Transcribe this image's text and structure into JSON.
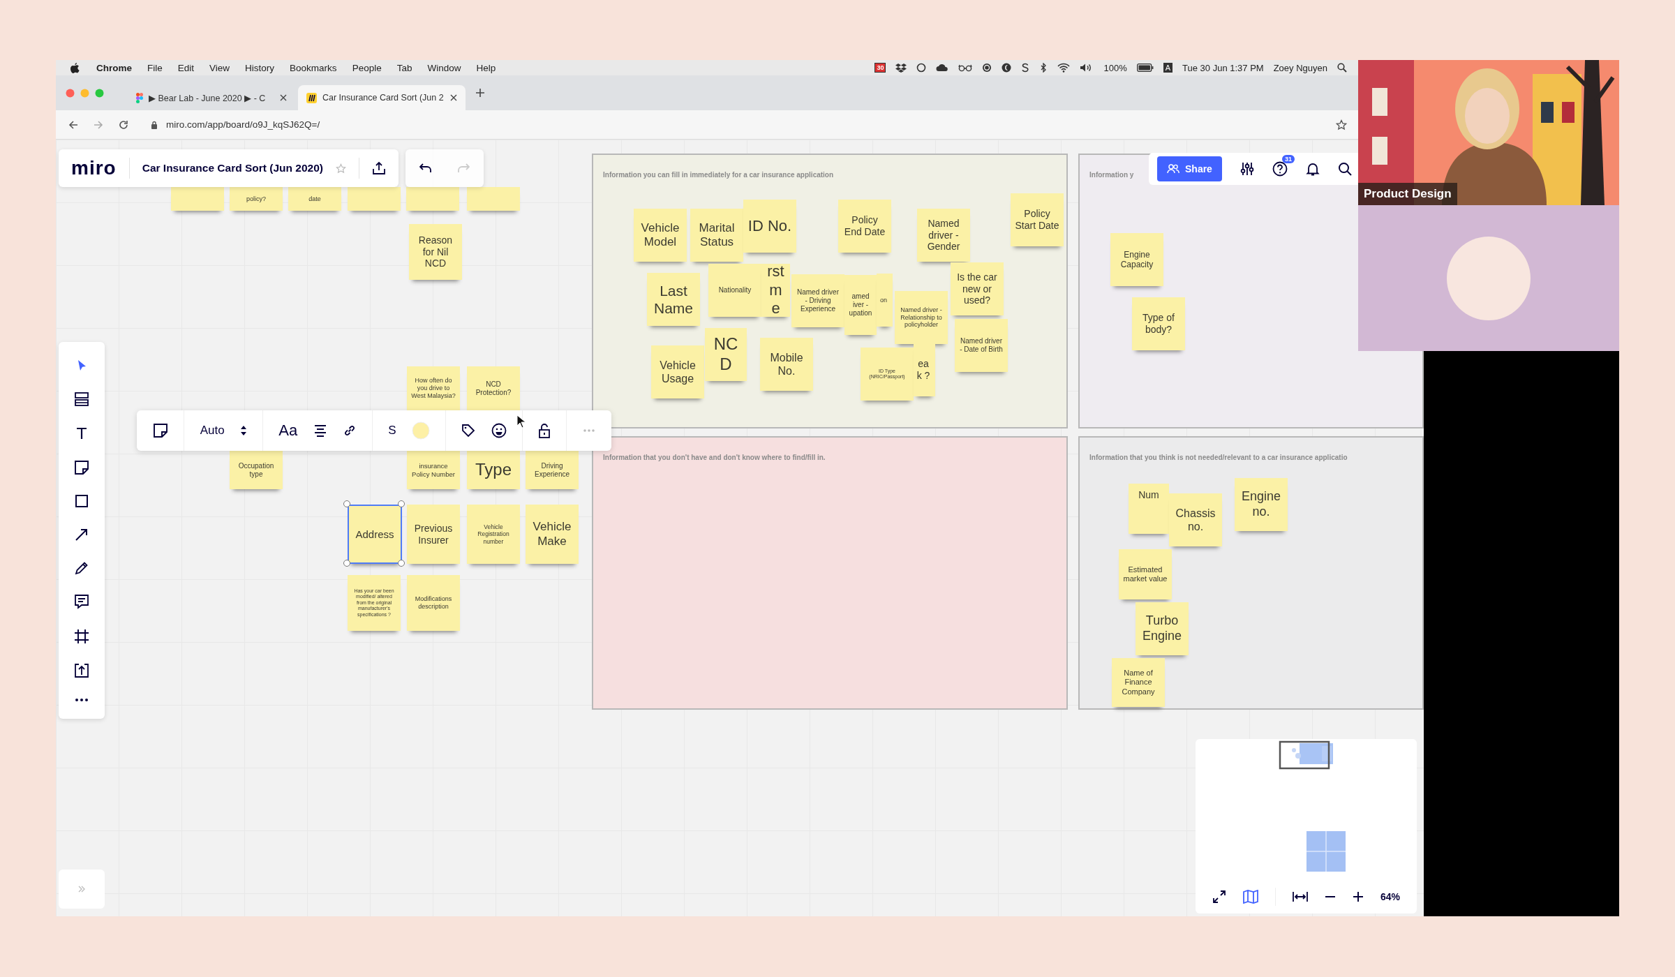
{
  "menu_bar": {
    "app": "Chrome",
    "menus": [
      "File",
      "Edit",
      "View",
      "History",
      "Bookmarks",
      "People",
      "Tab",
      "Window",
      "Help"
    ],
    "calendar_day": "30",
    "battery": "100%",
    "input_source": "A",
    "clock": "Tue 30 Jun 1:37 PM",
    "user": "Zoey Nguyen"
  },
  "tabs": [
    {
      "title": "▶ Bear Lab - June 2020 ▶ - C",
      "selected": false
    },
    {
      "title": "Car Insurance Card Sort (Jun 2",
      "selected": true
    }
  ],
  "address_bar": {
    "url": "miro.com/app/board/o9J_kqSJ62Q=/"
  },
  "board_header": {
    "logo": "miro",
    "title": "Car Insurance Card Sort (Jun 2020)",
    "share": "Share",
    "help_badge": "31"
  },
  "context_toolbar": {
    "font_size": "Auto",
    "font": "Aa",
    "shape": "S"
  },
  "loose_notes": [
    {
      "text": "policy?",
      "selected": false
    },
    {
      "text": "date",
      "selected": false
    },
    {
      "text": "Reason for Nil NCD",
      "selected": false
    },
    {
      "text": "How often do you drive to West Malaysia?",
      "selected": false
    },
    {
      "text": "NCD Protection?",
      "selected": false
    },
    {
      "text": "Occupation type",
      "selected": false
    },
    {
      "text": "insurance Policy Number",
      "selected": false
    },
    {
      "text": "Type",
      "selected": false
    },
    {
      "text": "Driving Experience",
      "selected": false
    },
    {
      "text": "Address",
      "selected": true
    },
    {
      "text": "Previous Insurer",
      "selected": false
    },
    {
      "text": "Vehicle Registration number",
      "selected": false
    },
    {
      "text": "Vehicle Make",
      "selected": false
    },
    {
      "text": "Has your car been modified/ altered from the original manufacturer's specifications ?",
      "selected": false
    },
    {
      "text": "Modifications description",
      "selected": false
    }
  ],
  "frames": [
    {
      "title": "Information you can fill in immediately for a car insurance application",
      "color": "#f0f0e5",
      "notes": [
        {
          "text": "Vehicle Model"
        },
        {
          "text": "Marital Status"
        },
        {
          "text": "ID No."
        },
        {
          "text": "Policy End Date"
        },
        {
          "text": "Named driver - Gender"
        },
        {
          "text": "Policy Start Date"
        },
        {
          "text": "Last Name"
        },
        {
          "text": "Nationality"
        },
        {
          "text": "rst me"
        },
        {
          "text": "Named driver - Driving Experience"
        },
        {
          "text": "amed iver - upation"
        },
        {
          "text": "on"
        },
        {
          "text": "Named driver - Relationship to policyholder"
        },
        {
          "text": "Is the car new or used?"
        },
        {
          "text": "Named driver - Date of Birth"
        },
        {
          "text": "Vehicle Usage"
        },
        {
          "text": "NCD"
        },
        {
          "text": "Mobile No."
        },
        {
          "text": "ID Type (NRIC/Passport)"
        },
        {
          "text": "eak ?"
        }
      ]
    },
    {
      "title": "Information y",
      "color": "#efecf1",
      "notes": [
        {
          "text": "Engine Capacity"
        },
        {
          "text": "Type of body?"
        }
      ]
    },
    {
      "title": "Information that you don't have and don't know where to find/fill in.",
      "color": "#f6dfdf"
    },
    {
      "title": "Information that you think is not needed/relevant to a car insurance applicatio",
      "color": "#ebebec",
      "notes": [
        {
          "text": "Num"
        },
        {
          "text": "Chassis no."
        },
        {
          "text": "Engine no."
        },
        {
          "text": "Estimated market value"
        },
        {
          "text": "Turbo Engine"
        },
        {
          "text": "Name of Finance Company"
        }
      ]
    }
  ],
  "video": {
    "label": "Product Design"
  },
  "zoom_bar": {
    "minimap_open": true,
    "zoom": "64%"
  }
}
